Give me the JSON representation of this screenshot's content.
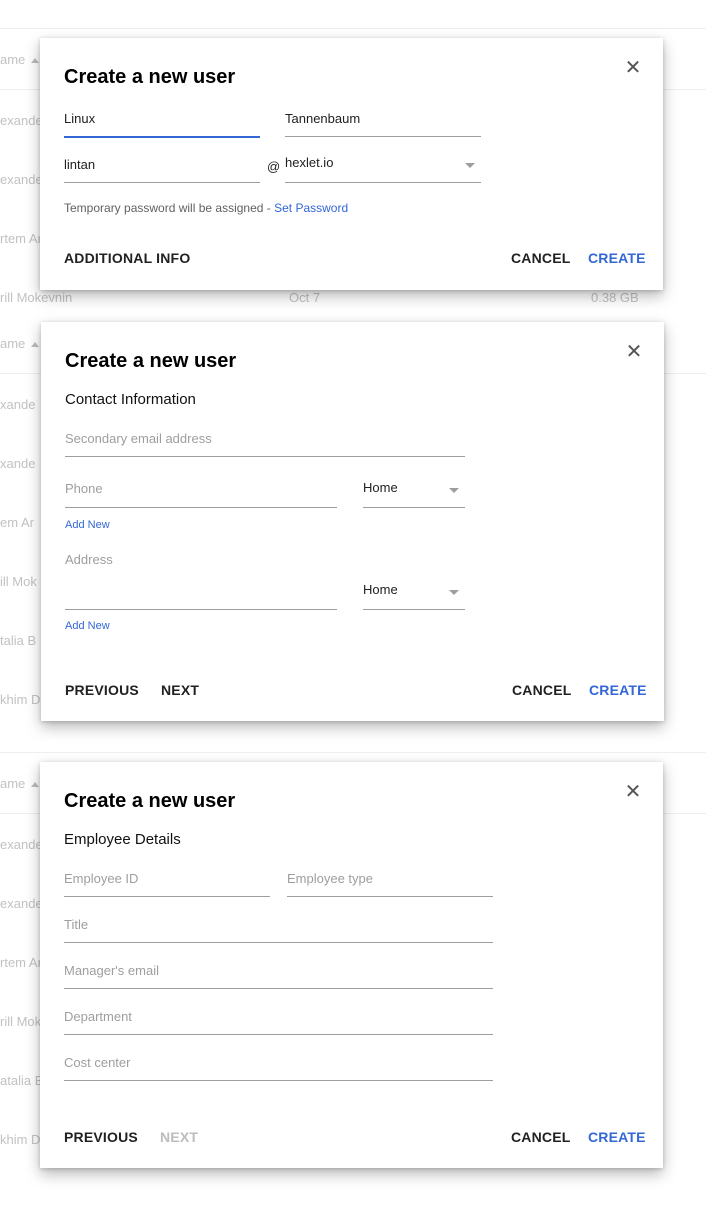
{
  "background": {
    "header_label": "ame",
    "rows_1": [
      "exande",
      "exande",
      "rtem Ar",
      "rill Mokevnin"
    ],
    "row_date": "Oct 7",
    "row_size": "0.38 GB",
    "rows_2": [
      "xande",
      "xande",
      "em Ar",
      "ill Mok",
      "talia B",
      "khim D"
    ],
    "rows_3": [
      "exande",
      "exande",
      "rtem Ar",
      "rill Mok",
      "atalia B",
      "khim D"
    ]
  },
  "dialog_1": {
    "title": "Create a new user",
    "first_name": "Linux",
    "last_name": "Tannenbaum",
    "username": "lintan",
    "at_sign": "@",
    "domain": "hexlet.io",
    "password_hint": "Temporary password will be assigned - ",
    "password_link": "Set Password",
    "additional_info": "ADDITIONAL INFO",
    "cancel": "CANCEL",
    "create": "CREATE"
  },
  "dialog_2": {
    "title": "Create a new user",
    "section": "Contact Information",
    "secondary_email_placeholder": "Secondary email address",
    "phone_placeholder": "Phone",
    "phone_type": "Home",
    "add_new_phone": "Add New",
    "address_placeholder": "Address",
    "address_type": "Home",
    "add_new_address": "Add New",
    "previous": "PREVIOUS",
    "next": "NEXT",
    "cancel": "CANCEL",
    "create": "CREATE"
  },
  "dialog_3": {
    "title": "Create a new user",
    "section": "Employee Details",
    "employee_id_placeholder": "Employee ID",
    "employee_type_placeholder": "Employee type",
    "title_placeholder": "Title",
    "manager_email_placeholder": "Manager's email",
    "department_placeholder": "Department",
    "cost_center_placeholder": "Cost center",
    "previous": "PREVIOUS",
    "next": "NEXT",
    "cancel": "CANCEL",
    "create": "CREATE"
  },
  "icons": {
    "close": "close-icon",
    "dropdown": "chevron-down-icon"
  },
  "colors": {
    "accent": "#3367d6",
    "disabled": "#bdbdbd"
  }
}
